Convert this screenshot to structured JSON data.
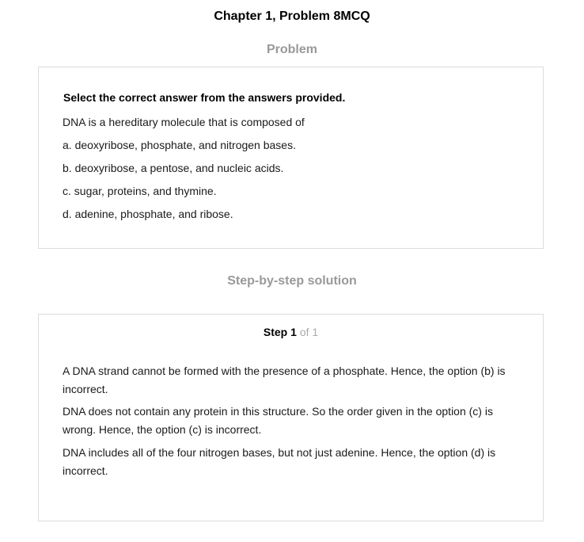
{
  "header": {
    "title": "Chapter 1, Problem 8MCQ"
  },
  "problem": {
    "heading": "Problem",
    "instruction": "Select the correct answer from the answers provided.",
    "question": "DNA is a hereditary molecule that is composed of",
    "options": [
      "a. deoxyribose, phosphate, and nitrogen bases.",
      "b. deoxyribose, a pentose, and nucleic acids.",
      "c. sugar, proteins, and thymine.",
      "d. adenine, phosphate, and ribose."
    ]
  },
  "solution": {
    "heading": "Step-by-step solution",
    "step_word": "Step",
    "step_number": "1",
    "step_of": "of 1",
    "paragraphs": [
      "A DNA strand cannot be formed with the presence of a phosphate. Hence, the option (b) is incorrect.",
      "DNA does not contain any protein in this structure. So the order given in the option (c) is wrong. Hence, the option (c) is incorrect.",
      "DNA includes all of the four nitrogen bases, but not just adenine. Hence, the option (d) is incorrect."
    ]
  }
}
